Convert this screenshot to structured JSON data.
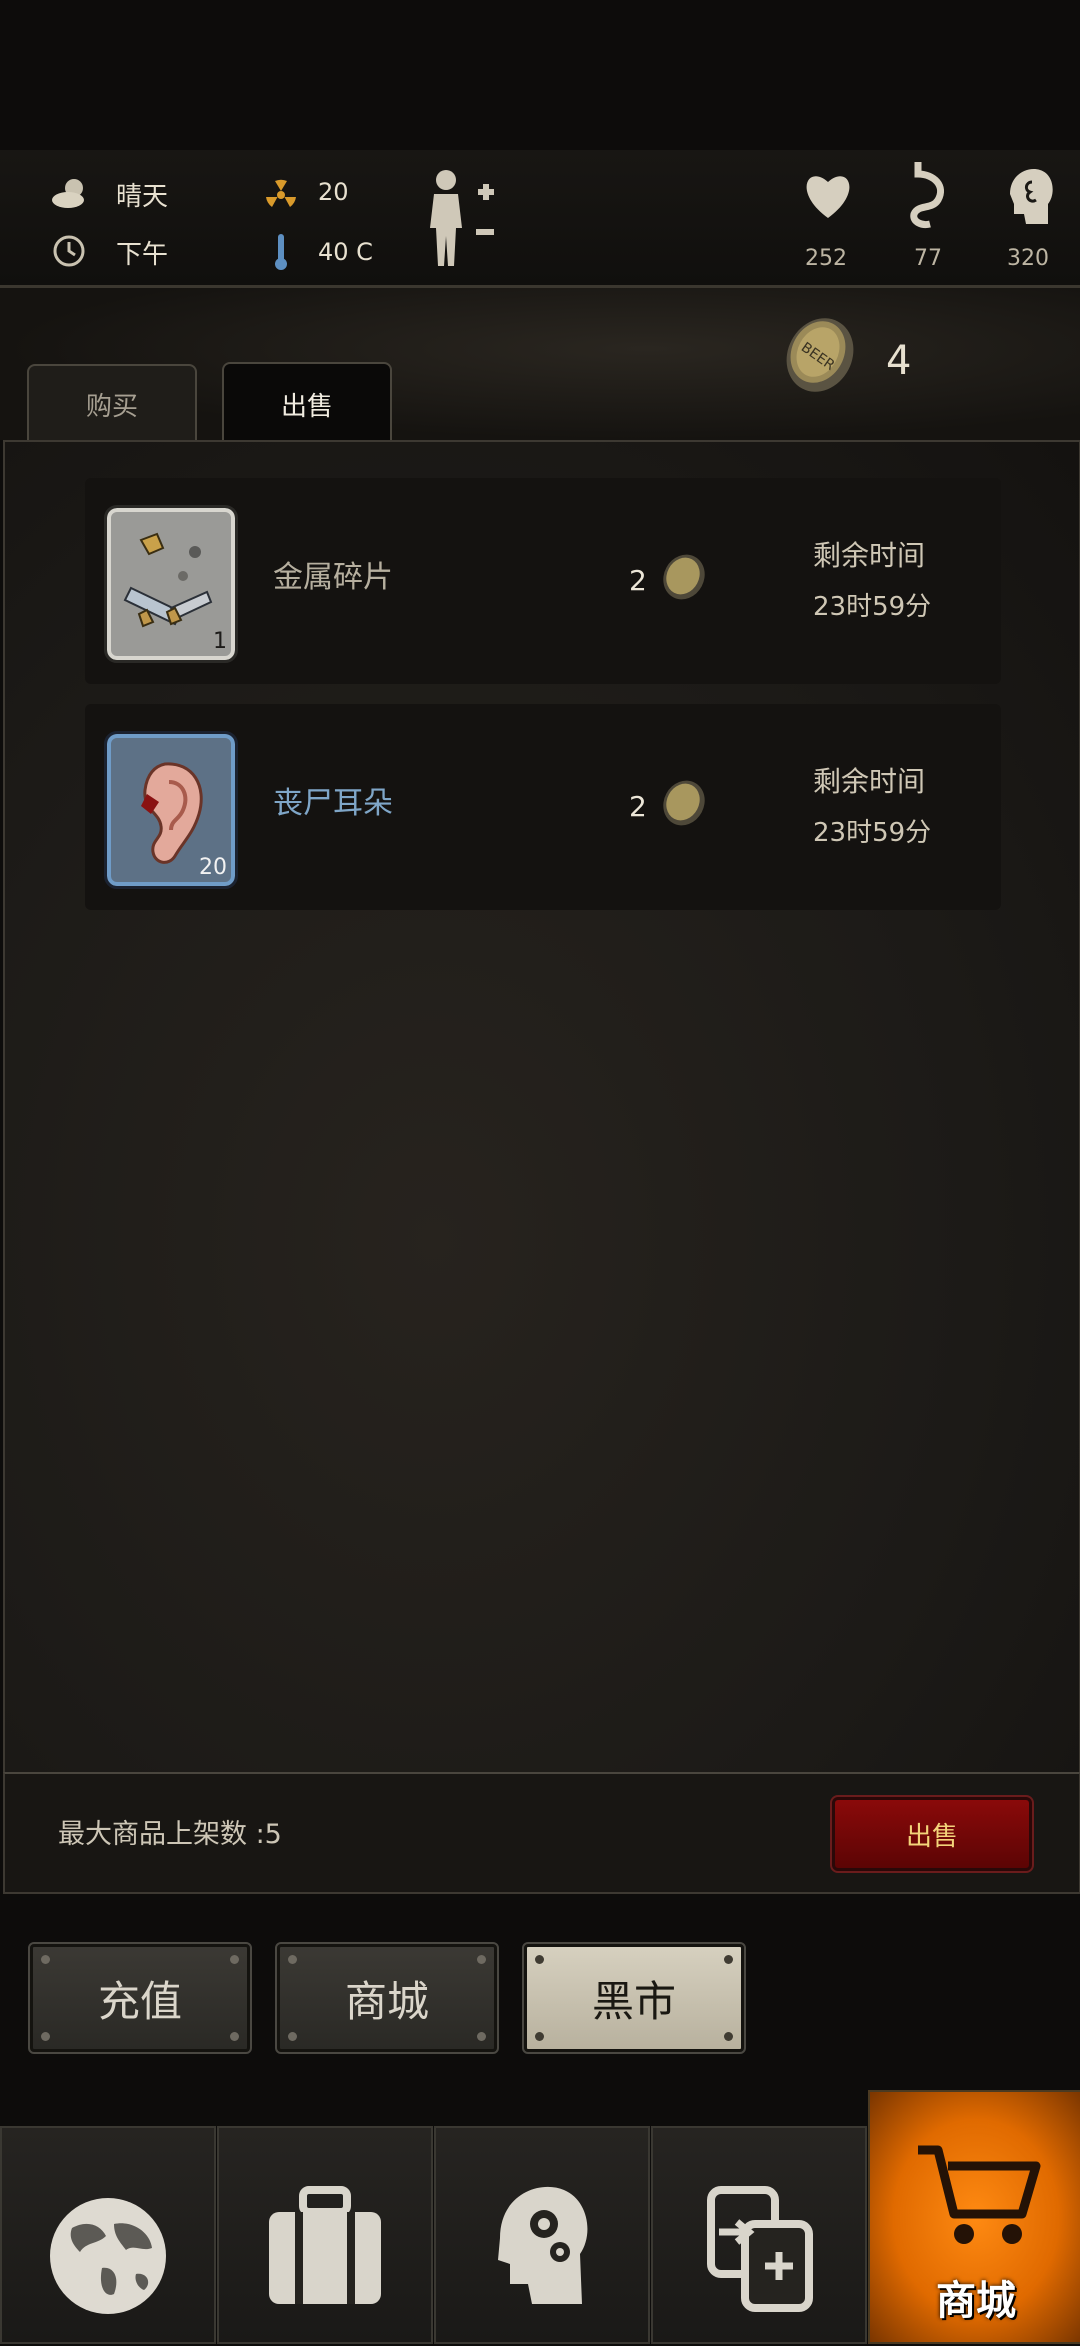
{
  "status": {
    "weather": "晴天",
    "time_of_day": "下午",
    "radiation": "20",
    "temperature": "40 C",
    "health": "252",
    "hunger": "77",
    "mental": "320"
  },
  "currency": {
    "amount": "4"
  },
  "tabs": {
    "buy": "购买",
    "sell": "出售"
  },
  "listings": [
    {
      "name": "金属碎片",
      "count": "1",
      "price": "2",
      "time_label": "剩余时间",
      "time_left": "23时59分"
    },
    {
      "name": "丧尸耳朵",
      "count": "20",
      "price": "2",
      "time_label": "剩余时间",
      "time_left": "23时59分"
    }
  ],
  "footer": {
    "max_listings": "最大商品上架数 :5",
    "sell_button": "出售"
  },
  "plaques": {
    "recharge": "充值",
    "mall": "商城",
    "black_market": "黑市"
  },
  "nav": {
    "shop_label": "商城"
  },
  "colors": {
    "accent_orange": "#e06a00",
    "sell_red": "#8a0a0a",
    "zombie_item_name": "#7fa6c8"
  }
}
